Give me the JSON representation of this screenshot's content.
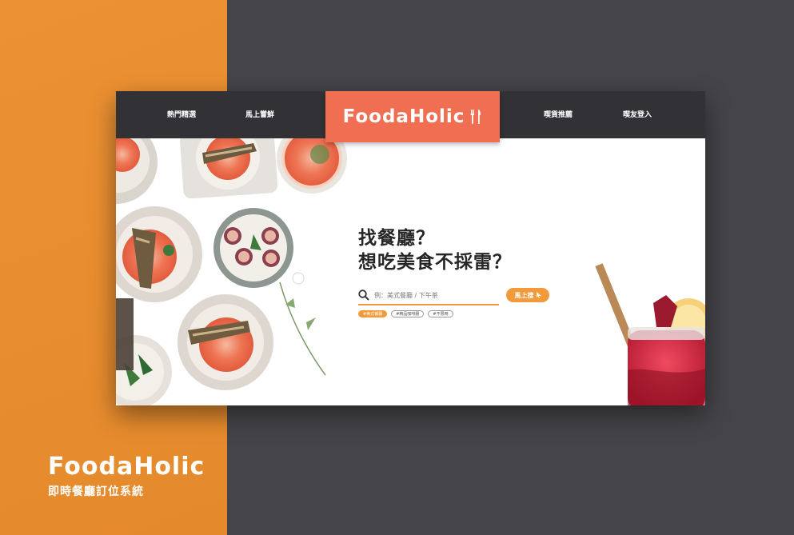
{
  "brand": {
    "name": "FoodaHolic",
    "tagline": "即時餐廳訂位系統"
  },
  "nav": {
    "left": [
      "熱門精選",
      "馬上嘗鮮"
    ],
    "right": [
      "喫貨推薦",
      "喫友登入"
    ],
    "logo": "FoodaHolic"
  },
  "hero": {
    "headline_line1": "找餐廳？",
    "headline_line2": "想吃美食不採雷？",
    "search_placeholder": "例：美式餐廳 / 下午茶",
    "search_button": "馬上搜",
    "tags": [
      "#美式餐廳",
      "#精品咖啡廳",
      "#不限時"
    ]
  },
  "colors": {
    "orange": "#ec9233",
    "coral": "#f06f52",
    "dark": "#323136",
    "background": "#454448"
  }
}
